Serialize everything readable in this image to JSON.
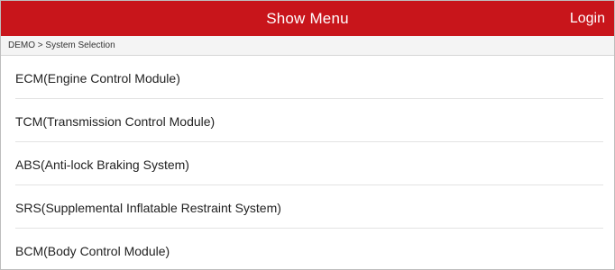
{
  "header": {
    "title": "Show Menu",
    "login_label": "Login",
    "background_color": "#c8151b"
  },
  "breadcrumb": {
    "text": "DEMO > System Selection"
  },
  "systems": [
    {
      "label": "ECM(Engine Control Module)"
    },
    {
      "label": "TCM(Transmission Control Module)"
    },
    {
      "label": "ABS(Anti-lock Braking System)"
    },
    {
      "label": "SRS(Supplemental Inflatable Restraint System)"
    },
    {
      "label": "BCM(Body Control Module)"
    }
  ]
}
